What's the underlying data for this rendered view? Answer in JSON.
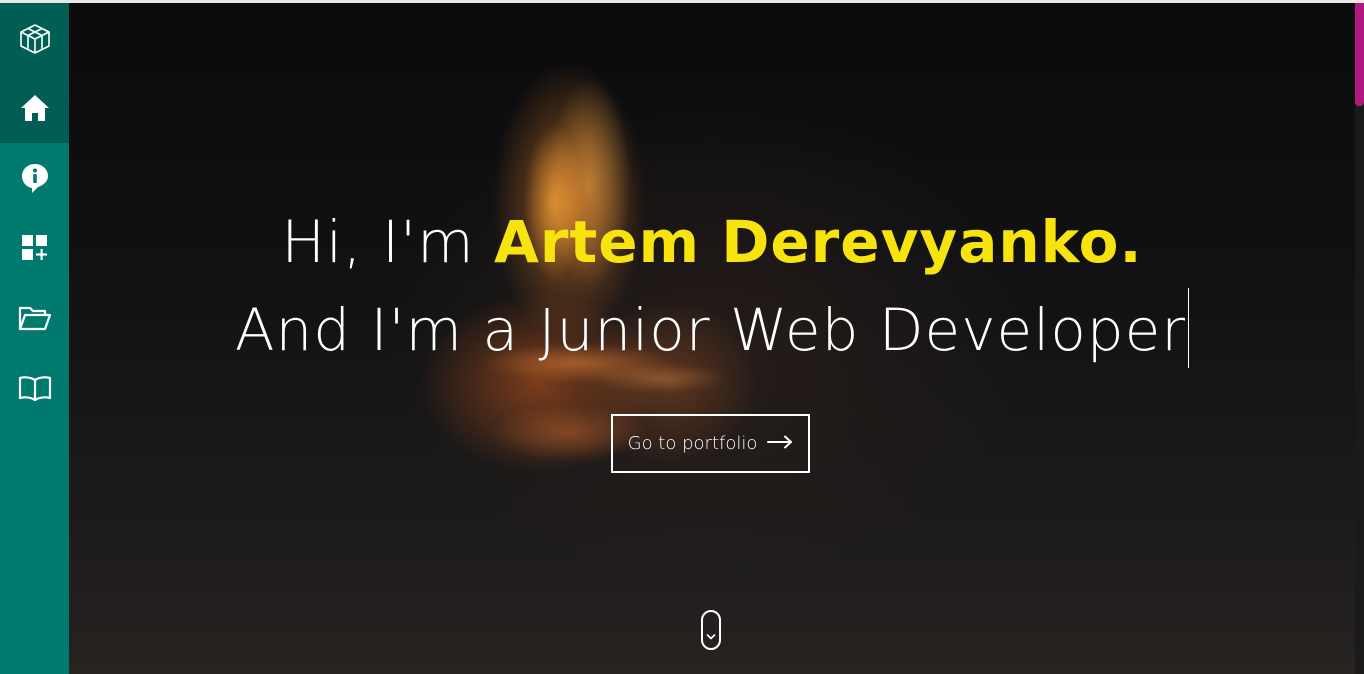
{
  "sidebar": {
    "logo_icon": "cube-logo-icon",
    "items": [
      {
        "icon": "home-icon",
        "active": true
      },
      {
        "icon": "info-bubble-icon",
        "active": false
      },
      {
        "icon": "dashboard-add-icon",
        "active": false
      },
      {
        "icon": "folder-open-icon",
        "active": false
      },
      {
        "icon": "book-icon",
        "active": false
      }
    ],
    "color": "#007a6e",
    "active_color": "#005e55"
  },
  "hero": {
    "greeting": "Hi, I'm",
    "name": "Artem Derevyanko.",
    "tagline": "And I'm a Junior Web Developer",
    "cta_label": "Go to portfolio",
    "cta_icon": "arrow-right-icon",
    "scroll_icon": "chevron-down-icon",
    "name_color": "#f7e30e"
  },
  "scrollbar": {
    "thumb_color": "#b0177f"
  }
}
